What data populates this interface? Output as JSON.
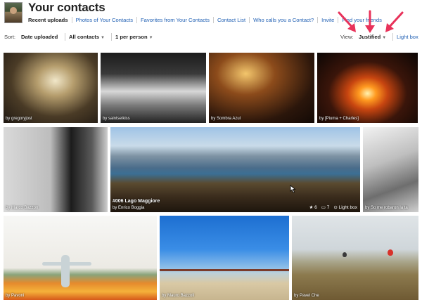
{
  "header": {
    "title": "Your contacts",
    "nav": [
      "Recent uploads",
      "Photos of Your Contacts",
      "Favorites from Your Contacts",
      "Contact List",
      "Who calls you a Contact?",
      "Invite",
      "Find your friends"
    ]
  },
  "toolbar": {
    "sort_label": "Sort:",
    "sort_value": "Date uploaded",
    "contacts_value": "All contacts",
    "per_person_value": "1 per person",
    "view_label": "View:",
    "view_value": "Justified",
    "lightbox_label": "Light box"
  },
  "photos": [
    {
      "credit": "by gregoryjost"
    },
    {
      "credit": "by saintseikiss"
    },
    {
      "credit": "by Sombra Azul"
    },
    {
      "credit": "by [Piuma + Charles]"
    },
    {
      "credit": "by Marco Bazzon"
    },
    {
      "title": "#006 Lago Maggiore",
      "credit": "by Enrico Boggia",
      "favorites": "6",
      "comments": "7",
      "lightbox": "Light box"
    },
    {
      "credit": "by So me robaron la ta"
    },
    {
      "credit": "by Pavoni"
    },
    {
      "credit": "by Mauro Bazzoli"
    },
    {
      "credit": "by Pavel Che"
    }
  ],
  "colors": {
    "link": "#1f5fb3",
    "arrow": "#e8325a"
  },
  "icons": [
    "star-icon",
    "comment-icon",
    "lightbox-icon",
    "caret-down-icon",
    "cursor-icon"
  ]
}
